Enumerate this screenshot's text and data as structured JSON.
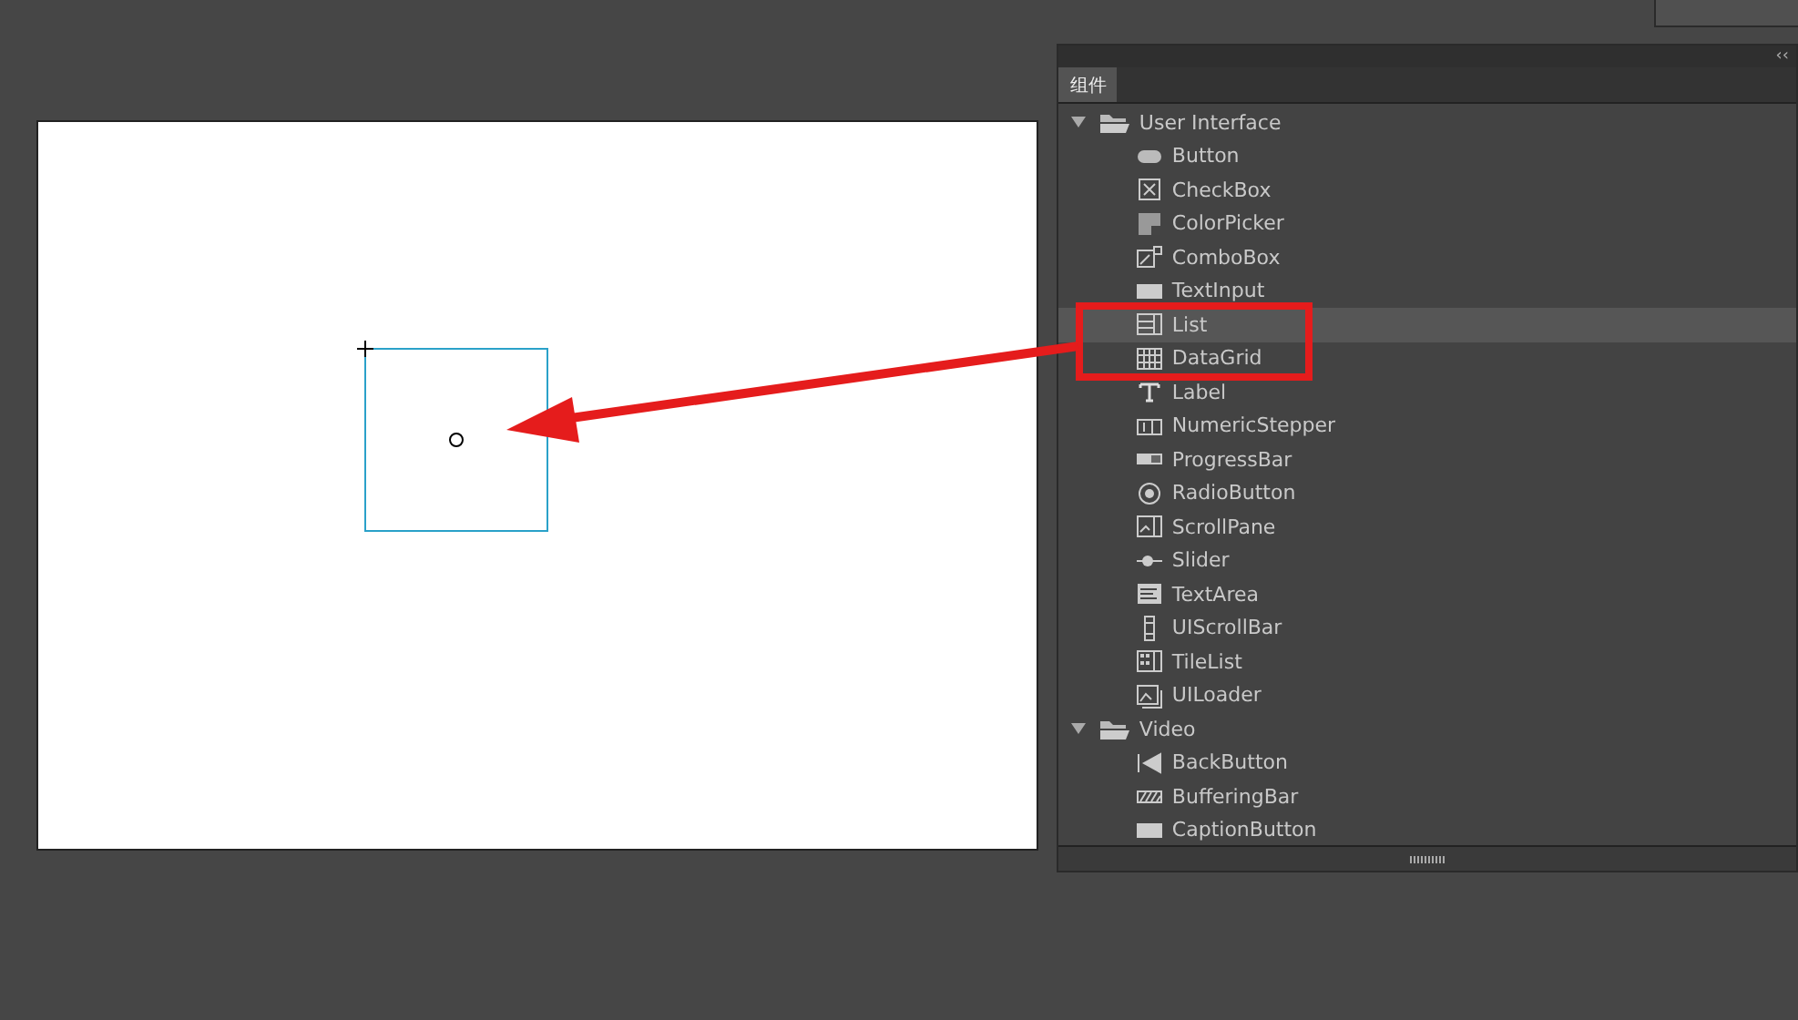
{
  "panel": {
    "collapse_label": "‹‹",
    "tabs": [
      {
        "label": "组件",
        "selected": true
      }
    ],
    "tree": [
      {
        "label": "User Interface",
        "expanded": true,
        "selected": false,
        "children": [
          {
            "label": "Button",
            "kind": "button",
            "selected": false
          },
          {
            "label": "CheckBox",
            "kind": "checkbox",
            "selected": false
          },
          {
            "label": "ColorPicker",
            "kind": "colorpicker",
            "selected": false
          },
          {
            "label": "ComboBox",
            "kind": "combobox",
            "selected": false
          },
          {
            "label": "TextInput",
            "kind": "textinput",
            "selected": false
          },
          {
            "label": "List",
            "kind": "list",
            "selected": true
          },
          {
            "label": "DataGrid",
            "kind": "datagrid",
            "selected": false
          },
          {
            "label": "Label",
            "kind": "label",
            "selected": false
          },
          {
            "label": "NumericStepper",
            "kind": "stepper",
            "selected": false
          },
          {
            "label": "ProgressBar",
            "kind": "progress",
            "selected": false
          },
          {
            "label": "RadioButton",
            "kind": "radio",
            "selected": false
          },
          {
            "label": "ScrollPane",
            "kind": "scrollpane",
            "selected": false
          },
          {
            "label": "Slider",
            "kind": "slider",
            "selected": false
          },
          {
            "label": "TextArea",
            "kind": "textarea",
            "selected": false
          },
          {
            "label": "UIScrollBar",
            "kind": "scrollbar",
            "selected": false
          },
          {
            "label": "TileList",
            "kind": "tilelist",
            "selected": false
          },
          {
            "label": "UILoader",
            "kind": "loader",
            "selected": false
          }
        ]
      },
      {
        "label": "Video",
        "expanded": true,
        "selected": false,
        "children": [
          {
            "label": "BackButton",
            "kind": "back",
            "selected": false
          },
          {
            "label": "BufferingBar",
            "kind": "buffering",
            "selected": false
          },
          {
            "label": "CaptionButton",
            "kind": "caption",
            "selected": false
          }
        ]
      }
    ]
  }
}
